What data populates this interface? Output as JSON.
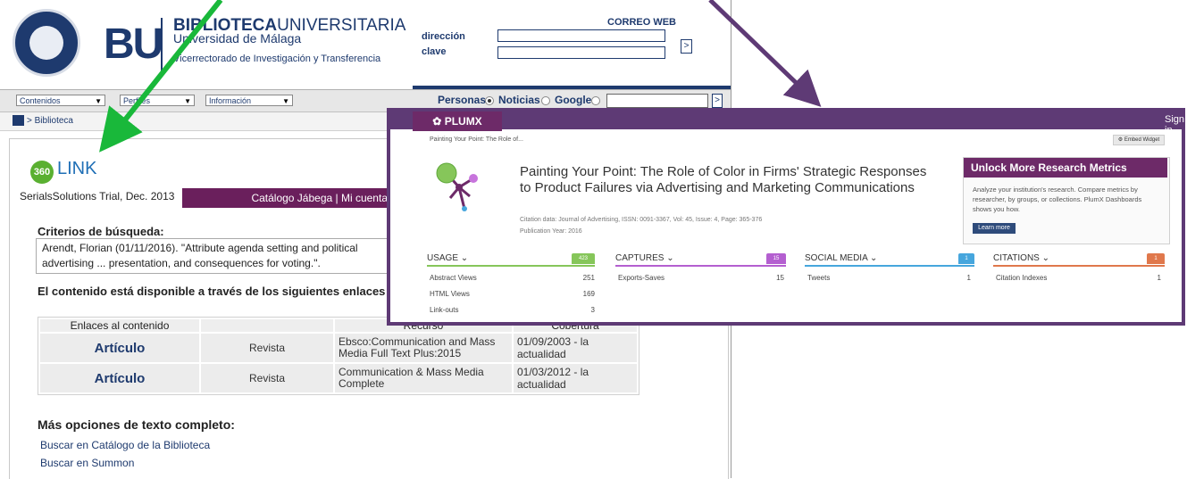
{
  "library": {
    "brand": {
      "bu": "BU",
      "title_bold": "BIBLIOTECA",
      "title_rest": "UNIVERSITARIA",
      "subtitle": "Universidad de Málaga",
      "vicerrectorado": "Vicerrectorado de Investigación y Transferencia"
    },
    "login": {
      "correo_label": "CORREO WEB",
      "direccion_label": "dirección",
      "clave_label": "clave",
      "go": ">"
    },
    "nav": {
      "menus": [
        "Contenidos",
        "Perfiles",
        "Información"
      ],
      "search_options": [
        "Personas",
        "Noticias",
        "Google"
      ],
      "selected_option": "Personas",
      "search_go": ">"
    },
    "breadcrumb": "> Biblioteca",
    "link360": {
      "badge": "360",
      "label": "LINK"
    },
    "trial": "SerialsSolutions Trial, Dec. 2013",
    "catalog_bar": "Catálogo Jábega  |  Mi cuenta",
    "criterios_heading": "Criterios de búsqueda:",
    "citation": "Arendt, Florian (01/11/2016). \"Attribute agenda setting and political advertising ... presentation, and consequences for voting.\". Communications (Sankt Augustin...",
    "disponible_heading": "El contenido está disponible a través de los siguientes enlaces",
    "table": {
      "headers": [
        "Enlaces al contenido",
        "",
        "Recurso",
        "Cobertura"
      ],
      "rows": [
        {
          "enlace": "Artículo",
          "tipo": "Revista",
          "recurso": "Ebsco:Communication and Mass Media Full Text Plus:2015",
          "cobertura": "01/09/2003 - la actualidad"
        },
        {
          "enlace": "Artículo",
          "tipo": "Revista",
          "recurso": "Communication & Mass Media Complete",
          "cobertura": "01/03/2012 - la actualidad"
        }
      ]
    },
    "mas_heading": "Más opciones de texto completo:",
    "links": [
      "Buscar en Catálogo de la Biblioteca",
      "Buscar en Summon"
    ]
  },
  "plumx": {
    "brand": "PLUMX",
    "sign_in": "Sign in",
    "crumb": "Painting Your Point: The Role of...",
    "embed": "Embed Widget",
    "title": "Painting Your Point: The Role of Color in Firms' Strategic Responses to Product Failures via Advertising and Marketing Communications",
    "citation_data": "Citation data: Journal of Advertising, ISSN: 0091-3367, Vol: 45, Issue: 4, Page: 365-376",
    "pub_year": "Publication Year: 2016",
    "unlock": {
      "heading": "Unlock More Research Metrics",
      "text": "Analyze your institution's research. Compare metrics by researcher, by groups, or collections. PlumX Dashboards shows you how.",
      "button": "Learn more"
    },
    "categories": [
      {
        "name": "USAGE",
        "total": "423",
        "color": "#86c65a",
        "metrics": [
          {
            "label": "Abstract Views",
            "value": "251"
          },
          {
            "label": "HTML Views",
            "value": "169"
          },
          {
            "label": "Link-outs",
            "value": "3"
          }
        ]
      },
      {
        "name": "CAPTURES",
        "total": "15",
        "color": "#b45fd0",
        "metrics": [
          {
            "label": "Exports-Saves",
            "value": "15"
          }
        ]
      },
      {
        "name": "SOCIAL MEDIA",
        "total": "1",
        "color": "#46a6dd",
        "metrics": [
          {
            "label": "Tweets",
            "value": "1"
          }
        ]
      },
      {
        "name": "CITATIONS",
        "total": "1",
        "color": "#e0784c",
        "metrics": [
          {
            "label": "Citation Indexes",
            "value": "1"
          }
        ]
      }
    ]
  },
  "colors": {
    "navy": "#1e3a6e",
    "plumx_purple": "#5e3a75",
    "arrow_green": "#19b83a",
    "arrow_purple": "#5e3a75"
  }
}
